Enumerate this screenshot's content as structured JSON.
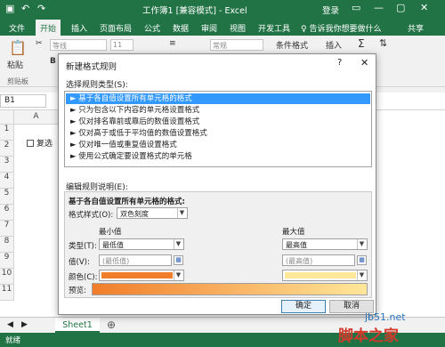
{
  "titlebar": {
    "title": "工作簿1 [兼容模式] - Excel",
    "login": "登录",
    "save_icon": "save-icon",
    "undo_icon": "undo-icon"
  },
  "ribbon_tabs": [
    "文件",
    "开始",
    "插入",
    "页面布局",
    "公式",
    "数据",
    "审阅",
    "视图",
    "开发工具"
  ],
  "ribbon_tabs_extra": {
    "tell_me": "♀ 告诉我你想要做什么",
    "share": "共享"
  },
  "ribbon": {
    "paste": "粘贴",
    "clipboard": "剪贴板",
    "font_name": "等线",
    "font_size": "11",
    "wrap": "常规",
    "cond_format": "条件格式",
    "insert": "插入"
  },
  "formula_bar": {
    "name_box": "B1"
  },
  "sheet": {
    "col_a": "A",
    "rows": [
      "1",
      "2",
      "3",
      "4",
      "5",
      "6",
      "7",
      "8",
      "9",
      "10",
      "11"
    ],
    "checkbox_label": "复选"
  },
  "sheet_tabs": {
    "tab1": "Sheet1"
  },
  "status": {
    "text": "就绪"
  },
  "dialog": {
    "title": "新建格式规则",
    "help": "?",
    "close": "✕",
    "select_type_label": "选择规则类型(S):",
    "rules": [
      "► 基于各自值设置所有单元格的格式",
      "► 只为包含以下内容的单元格设置格式",
      "► 仅对排名靠前或靠后的数值设置格式",
      "► 仅对高于或低于平均值的数值设置格式",
      "► 仅对唯一值或重复值设置格式",
      "► 使用公式确定要设置格式的单元格"
    ],
    "edit_label": "编辑规则说明(E):",
    "edit_heading": "基于各自值设置所有单元格的格式:",
    "format_style_label": "格式样式(O):",
    "format_style_value": "双色刻度",
    "min_header": "最小值",
    "max_header": "最大值",
    "type_label": "类型(T):",
    "min_type": "最低值",
    "max_type": "最高值",
    "value_label": "值(V):",
    "min_value_placeholder": "(最低值)",
    "max_value_placeholder": "(最高值)",
    "color_label": "颜色(C):",
    "preview_label": "预览:",
    "ok": "确定",
    "cancel": "取消"
  },
  "colors": {
    "excel_green": "#217346",
    "min_color": "#f07d2a",
    "max_color": "#ffe79a",
    "selection_blue": "#3399ff"
  },
  "watermark": {
    "line1": "jb51.net",
    "line2": "脚本之家"
  }
}
